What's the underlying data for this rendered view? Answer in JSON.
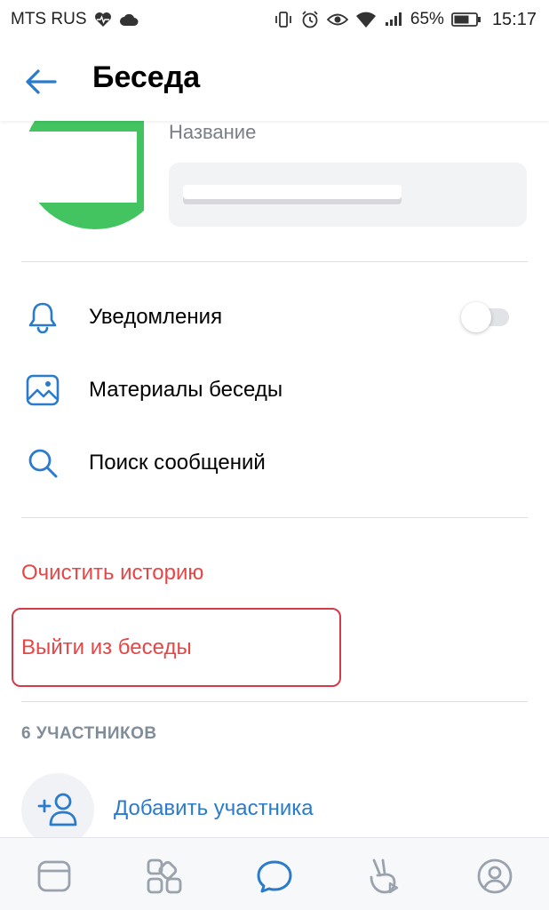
{
  "status_bar": {
    "carrier": "MTS RUS",
    "battery": "65%",
    "time": "15:17"
  },
  "header": {
    "title": "Беседа"
  },
  "chat": {
    "name_label": "Название"
  },
  "menu": {
    "notifications": "Уведомления",
    "notifications_enabled": false,
    "materials": "Материалы беседы",
    "search": "Поиск сообщений"
  },
  "actions": {
    "clear_history": "Очистить историю",
    "leave_chat": "Выйти из беседы"
  },
  "members": {
    "section_title": "6 УЧАСТНИКОВ",
    "add_member": "Добавить участника"
  },
  "colors": {
    "accent": "#2a7bcc",
    "danger": "#e64646",
    "avatar": "#43c461",
    "highlight": "#d43a4a"
  },
  "bottom_nav": {
    "items": [
      "news-icon",
      "services-icon",
      "messages-icon",
      "clips-icon",
      "profile-icon"
    ],
    "active": "messages-icon"
  }
}
